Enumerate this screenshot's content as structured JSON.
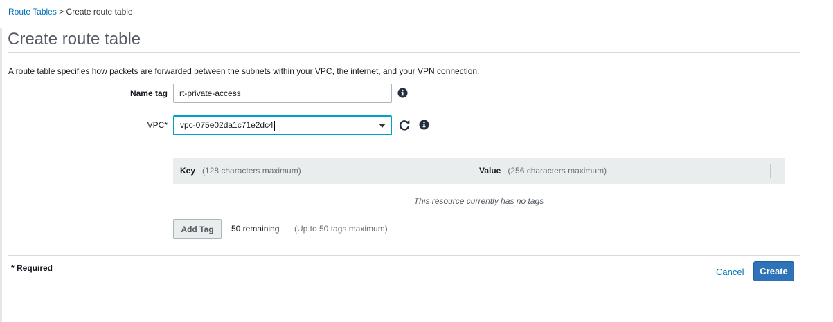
{
  "breadcrumb": {
    "parent": "Route Tables",
    "separator": ">",
    "current": "Create route table"
  },
  "page": {
    "title": "Create route table",
    "description": "A route table specifies how packets are forwarded between the subnets within your VPC, the internet, and your VPN connection."
  },
  "form": {
    "name_tag": {
      "label": "Name tag",
      "value": "rt-private-access",
      "icon": "info-icon"
    },
    "vpc": {
      "label": "VPC*",
      "value": "vpc-075e02da1c71e2dc4",
      "refresh_icon": "refresh-icon",
      "info_icon": "info-icon"
    }
  },
  "tags": {
    "columns": [
      {
        "label": "Key",
        "hint": "(128 characters maximum)"
      },
      {
        "label": "Value",
        "hint": "(256 characters maximum)"
      }
    ],
    "empty_message": "This resource currently has no tags",
    "add_tag_label": "Add Tag",
    "remaining": "50 remaining",
    "remaining_hint": "(Up to 50 tags maximum)"
  },
  "footer": {
    "required_note": "* Required",
    "cancel_label": "Cancel",
    "create_label": "Create"
  },
  "colors": {
    "link": "#0073bb",
    "primary_button": "#2e73b8",
    "focus_border": "#00a1c9",
    "header_bg": "#eaeded"
  }
}
